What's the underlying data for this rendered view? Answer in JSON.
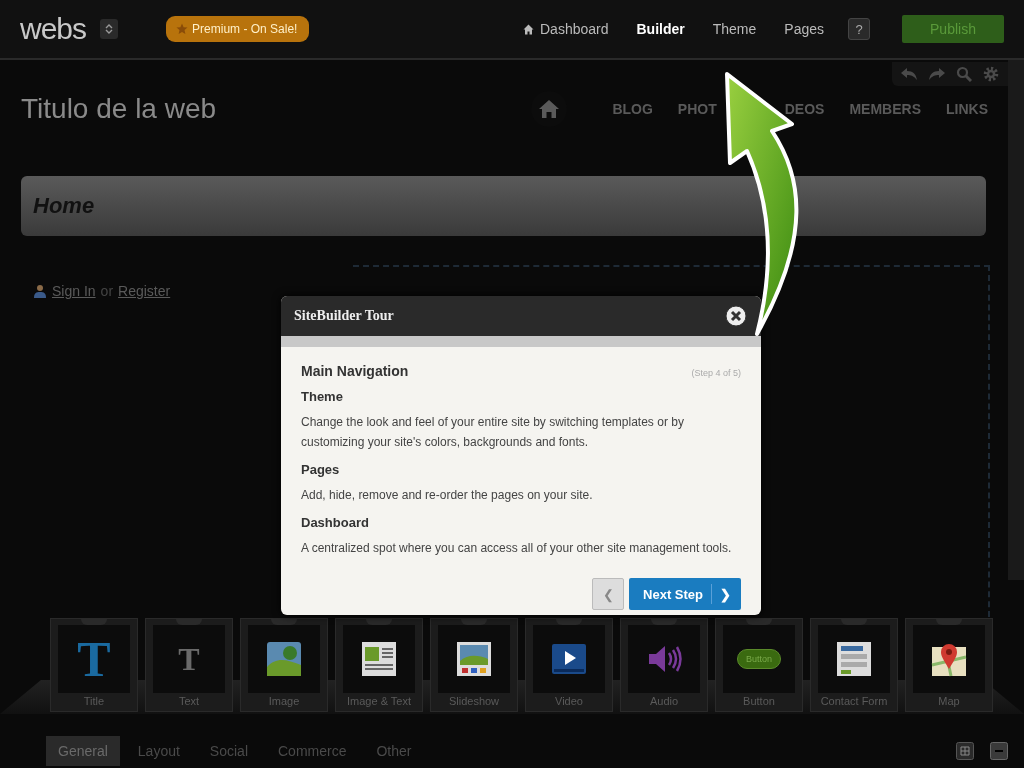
{
  "topbar": {
    "logo": "webs",
    "premium": "Premium - On Sale!",
    "nav": [
      {
        "label": "Dashboard",
        "selected": false,
        "kind": "home"
      },
      {
        "label": "Builder",
        "selected": true,
        "kind": "plain"
      },
      {
        "label": "Theme",
        "selected": false,
        "kind": "plain"
      },
      {
        "label": "Pages",
        "selected": false,
        "kind": "plain"
      }
    ],
    "help": "?",
    "publish": "Publish"
  },
  "site": {
    "title": "Titulo de la web",
    "nav": [
      "BLOG",
      "PHOT",
      "DEOS",
      "MEMBERS",
      "LINKS"
    ],
    "page_title": "Home",
    "sign_in": "Sign In",
    "or": "or",
    "register": "Register"
  },
  "tour": {
    "title": "SiteBuilder Tour",
    "heading": "Main Navigation",
    "step": "(Step 4 of 5)",
    "sections": [
      {
        "title": "Theme",
        "text": "Change the look and feel of your entire site by switching templates or by customizing your site's colors, backgrounds and fonts."
      },
      {
        "title": "Pages",
        "text": "Add, hide, remove and re-order the pages on your site."
      },
      {
        "title": "Dashboard",
        "text": "A centralized spot where you can access all of your other site management tools."
      }
    ],
    "prev": "❮",
    "next": "Next Step",
    "next_arrow": "❯"
  },
  "widgets": [
    {
      "label": "Title",
      "kind": "title",
      "glyph": "T"
    },
    {
      "label": "Text",
      "kind": "text",
      "glyph": "T"
    },
    {
      "label": "Image",
      "kind": "image"
    },
    {
      "label": "Image & Text",
      "kind": "imagetext"
    },
    {
      "label": "Slideshow",
      "kind": "slideshow"
    },
    {
      "label": "Video",
      "kind": "video"
    },
    {
      "label": "Audio",
      "kind": "audio"
    },
    {
      "label": "Button",
      "kind": "button",
      "caption": "Button"
    },
    {
      "label": "Contact Form",
      "kind": "form"
    },
    {
      "label": "Map",
      "kind": "map"
    }
  ],
  "tabs": [
    {
      "label": "General",
      "selected": true
    },
    {
      "label": "Layout",
      "selected": false
    },
    {
      "label": "Social",
      "selected": false
    },
    {
      "label": "Commerce",
      "selected": false
    },
    {
      "label": "Other",
      "selected": false
    }
  ]
}
